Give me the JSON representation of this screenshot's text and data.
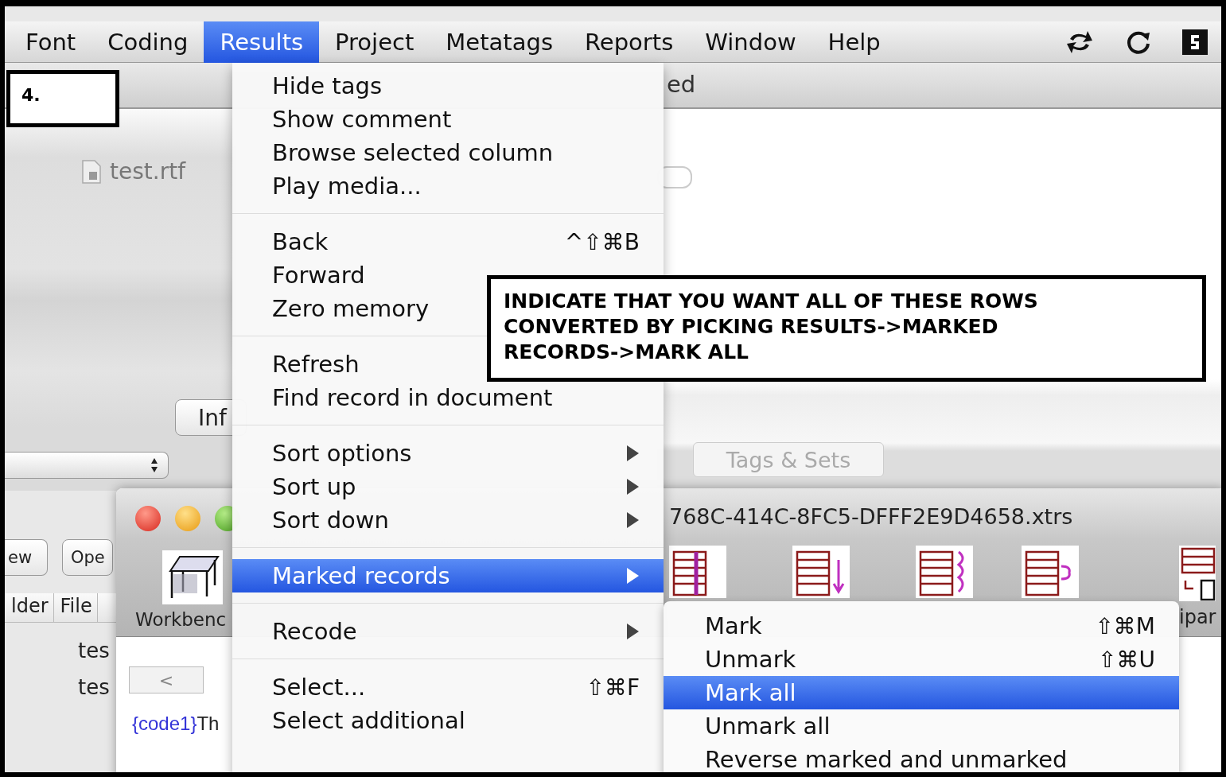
{
  "menu_bar": {
    "items": [
      {
        "label": "Font",
        "selected": false
      },
      {
        "label": "Coding",
        "selected": false
      },
      {
        "label": "Results",
        "selected": true
      },
      {
        "label": "Project",
        "selected": false
      },
      {
        "label": "Metatags",
        "selected": false
      },
      {
        "label": "Reports",
        "selected": false
      },
      {
        "label": "Window",
        "selected": false
      },
      {
        "label": "Help",
        "selected": false
      }
    ]
  },
  "step_label": "4.",
  "background_window": {
    "toolbar_text": "ed",
    "file": "test.rtf",
    "info_button": "Inf",
    "tab": "Tags & Sets",
    "buttons": [
      "ew",
      "Ope"
    ],
    "columns": [
      "lder",
      "File"
    ],
    "rows": [
      "tes",
      "tes"
    ]
  },
  "document_window": {
    "title": "768C-414C-8FC5-DFFF2E9D4658.xtrs",
    "toolbar_label": "Workbenc",
    "side_label": "ipar",
    "back_button": "<",
    "code_tag": "{code1}",
    "content": "Th"
  },
  "results_menu": {
    "items": [
      {
        "kind": "item",
        "label": "Hide tags",
        "selected": false
      },
      {
        "kind": "item",
        "label": "Show comment",
        "selected": false
      },
      {
        "kind": "item",
        "label": "Browse selected column",
        "selected": false
      },
      {
        "kind": "item",
        "label": "Play media...",
        "selected": false
      },
      {
        "kind": "separator"
      },
      {
        "kind": "item",
        "label": "Back",
        "shortcut": "^⇧⌘B",
        "selected": false
      },
      {
        "kind": "item",
        "label": "Forward",
        "selected": false
      },
      {
        "kind": "item",
        "label": "Zero memory",
        "selected": false
      },
      {
        "kind": "separator"
      },
      {
        "kind": "item",
        "label": "Refresh",
        "selected": false
      },
      {
        "kind": "item",
        "label": "Find record in document",
        "selected": false
      },
      {
        "kind": "separator"
      },
      {
        "kind": "submenu",
        "label": "Sort options",
        "selected": false
      },
      {
        "kind": "submenu",
        "label": "Sort up",
        "selected": false
      },
      {
        "kind": "submenu",
        "label": "Sort down",
        "selected": false
      },
      {
        "kind": "separator"
      },
      {
        "kind": "submenu",
        "label": "Marked records",
        "selected": true
      },
      {
        "kind": "separator"
      },
      {
        "kind": "submenu",
        "label": "Recode",
        "selected": false
      },
      {
        "kind": "separator"
      },
      {
        "kind": "item",
        "label": "Select...",
        "shortcut": "⇧⌘F",
        "selected": false
      },
      {
        "kind": "item",
        "label": "Select additional",
        "selected": false
      }
    ]
  },
  "submenu": {
    "items": [
      {
        "label": "Mark",
        "shortcut": "⇧⌘M",
        "selected": false
      },
      {
        "label": "Unmark",
        "shortcut": "⇧⌘U",
        "selected": false
      },
      {
        "label": "Mark all",
        "selected": true
      },
      {
        "label": "Unmark all",
        "selected": false
      },
      {
        "label": "Reverse marked and unmarked",
        "selected": false
      }
    ]
  },
  "note": {
    "text": "INDICATE THAT YOU WANT ALL OF THESE ROWS CONVERTED BY PICKING RESULTS->MARKED RECORDS->MARK ALL"
  }
}
